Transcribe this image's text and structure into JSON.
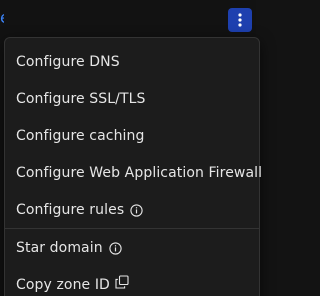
{
  "header": {
    "link_fragment": "e"
  },
  "menu": {
    "items": [
      {
        "label": "Configure DNS"
      },
      {
        "label": "Configure SSL/TLS"
      },
      {
        "label": "Configure caching"
      },
      {
        "label": "Configure Web Application Firewall"
      },
      {
        "label": "Configure rules",
        "icon": "info-icon"
      },
      {
        "label": "Star domain",
        "icon": "info-icon"
      },
      {
        "label": "Copy zone ID",
        "icon": "copy-icon"
      }
    ]
  },
  "colors": {
    "background": "#121212",
    "menu_background": "#1c1c1c",
    "menu_border": "#333333",
    "text": "#e6e6e6",
    "accent": "#1e40af",
    "link": "#3b82f6"
  }
}
